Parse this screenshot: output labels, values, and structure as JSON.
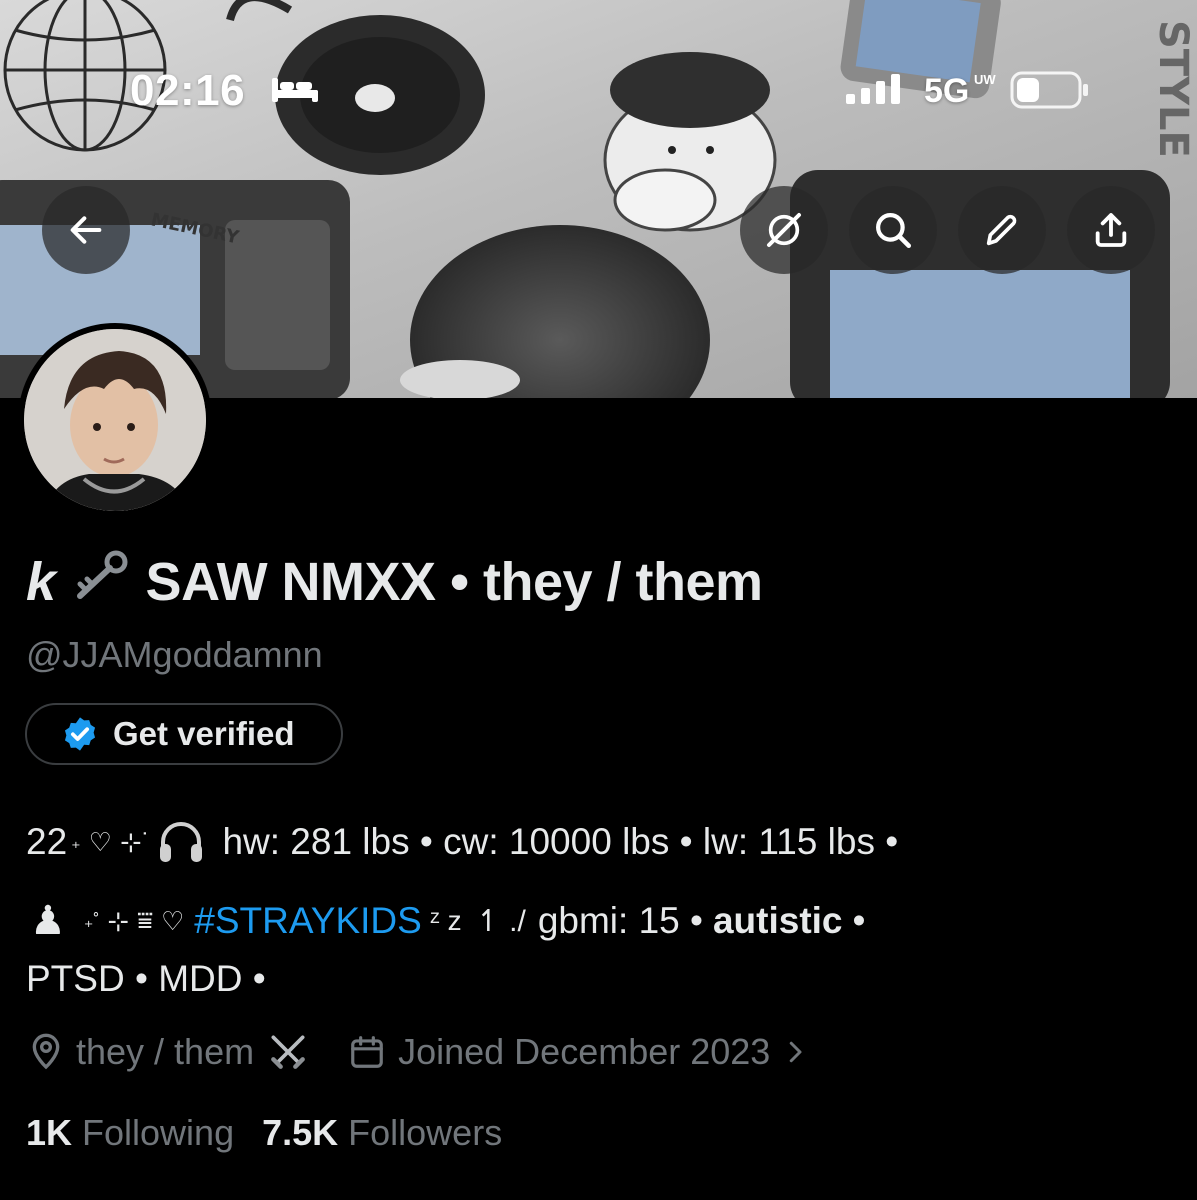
{
  "status_bar": {
    "time": "02:16",
    "network": "5G",
    "network_suffix": "UW",
    "sleep_icon": "bed-icon",
    "signal_icon": "cellular-signal-icon",
    "battery_icon": "battery-icon"
  },
  "header": {
    "back_icon": "arrow-left-icon",
    "actions": [
      {
        "icon": "grok-icon"
      },
      {
        "icon": "search-icon"
      },
      {
        "icon": "pencil-icon"
      },
      {
        "icon": "share-icon"
      }
    ]
  },
  "banner": {
    "text_memory": "MEMORY",
    "text_style": "STYLE"
  },
  "profile": {
    "name_prefix": "k",
    "name_icon": "key-emoji",
    "name": "SAW NMXX • they / them",
    "handle": "@JJAMgoddamnn",
    "get_verified": "Get verified",
    "bio": {
      "line1": {
        "age": "22",
        "text": "hw: 281 lbs • cw: 10000 lbs • lw: 115 lbs •"
      },
      "line2": {
        "hashtag": "#STRAYKIDS",
        "zz": "ᶻ z",
        "text_a": "gbmi: 15 •",
        "bold": "autistic",
        "text_b": "•"
      },
      "line3": "PTSD • MDD •"
    },
    "location": "they / them",
    "joined": "Joined December 2023",
    "following_count": "1K",
    "following_label": "Following",
    "followers_count": "7.5K",
    "followers_label": "Followers"
  },
  "colors": {
    "background": "#000000",
    "text": "#e7e9ea",
    "muted": "#71767b",
    "accent": "#1d9bf0"
  }
}
